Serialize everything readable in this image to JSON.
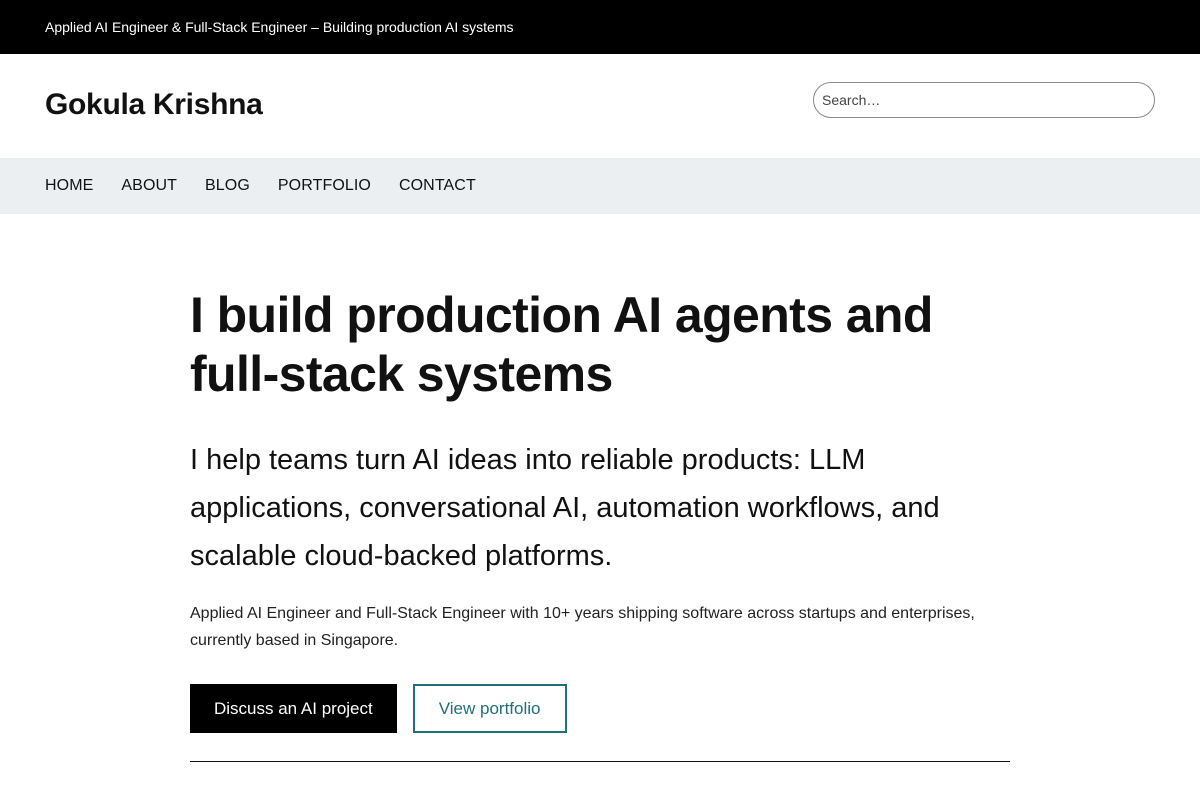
{
  "topbar": {
    "tagline": "Applied AI Engineer & Full-Stack Engineer – Building production AI systems"
  },
  "header": {
    "site_title": "Gokula Krishna",
    "search": {
      "placeholder": "Search…",
      "value": ""
    }
  },
  "nav": {
    "items": [
      {
        "label": "HOME"
      },
      {
        "label": "ABOUT"
      },
      {
        "label": "BLOG"
      },
      {
        "label": "PORTFOLIO"
      },
      {
        "label": "CONTACT"
      }
    ]
  },
  "hero": {
    "title": "I build production AI agents and full-stack systems",
    "lead": "I help teams turn AI ideas into reliable products: LLM applications, conversational AI, automation workflows, and scalable cloud-backed platforms.",
    "body": "Applied AI Engineer and Full-Stack Engineer with 10+ years shipping software across startups and enterprises, currently based in Singapore.",
    "primary_cta": "Discuss an AI project",
    "secondary_cta": "View portfolio"
  },
  "colors": {
    "topbar_bg": "#000000",
    "nav_bg": "#ebeff2",
    "accent": "#1f7079"
  }
}
